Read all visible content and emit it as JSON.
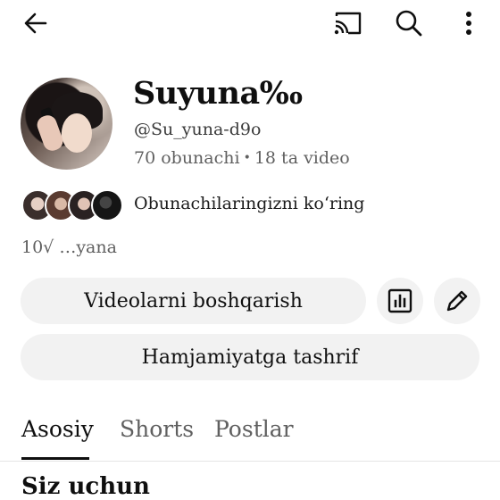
{
  "top_bar": {
    "back_icon": "arrow-left-icon",
    "cast_icon": "cast-icon",
    "search_icon": "search-icon",
    "more_icon": "more-vertical-icon"
  },
  "channel": {
    "name": "Suyuna‰",
    "handle": "@Su_yuna-d9o",
    "subscribers": "70 obunachi",
    "separator": "•",
    "videos": "18 ta video",
    "subscribers_link": "Obunachilaringizni koʻring",
    "description": "10√ …yana"
  },
  "actions": {
    "manage_videos": "Videolarni boshqarish",
    "visit_community": "Hamjamiyatga tashrif",
    "analytics_icon": "analytics-icon",
    "edit_icon": "pencil-icon"
  },
  "tabs": [
    {
      "label": "Asosiy",
      "active": true
    },
    {
      "label": "Shorts",
      "active": false
    },
    {
      "label": "Postlar",
      "active": false
    }
  ],
  "section": {
    "title": "Siz uchun"
  }
}
